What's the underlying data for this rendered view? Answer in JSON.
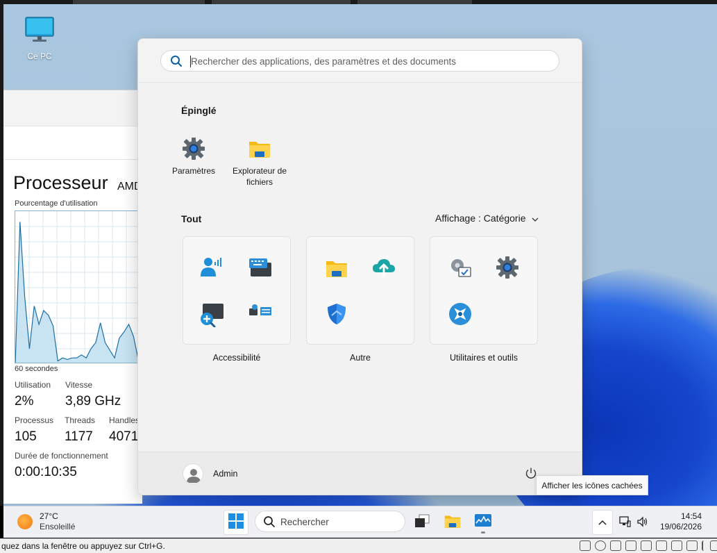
{
  "desktop": {
    "icon_label": "Ce PC"
  },
  "taskmgr": {
    "title": "Processeur",
    "model": "AMD",
    "graph_label": "Pourcentage d'utilisation",
    "graph_footer": "60 secondes",
    "stats": {
      "utilisation_label": "Utilisation",
      "utilisation_value": "2%",
      "vitesse_label": "Vitesse",
      "vitesse_value": "3,89 GHz",
      "processus_label": "Processus",
      "processus_value": "105",
      "threads_label": "Threads",
      "threads_value": "1177",
      "handles_label": "Handles",
      "handles_value": "4071",
      "uptime_label": "Durée de fonctionnement",
      "uptime_value": "0:00:10:35"
    },
    "graph_values": [
      0,
      93,
      44,
      10,
      38,
      26,
      35,
      32,
      25,
      2,
      4,
      3,
      4,
      4,
      6,
      4,
      10,
      14,
      27,
      14,
      9,
      4,
      17,
      21,
      26,
      18,
      3,
      3
    ]
  },
  "start_menu": {
    "search_placeholder": "Rechercher des applications, des paramètres et des documents",
    "pinned_title": "Épinglé",
    "pinned": [
      {
        "label": "Paramètres",
        "icon": "settings-gear-icon"
      },
      {
        "label": "Explorateur de fichiers",
        "icon": "file-explorer-icon"
      }
    ],
    "all_title": "Tout",
    "view_label": "Affichage : Catégorie",
    "categories": [
      {
        "label": "Accessibilité",
        "icons": [
          "narrator-icon",
          "on-screen-keyboard-icon",
          "magnifier-icon",
          "voice-access-icon"
        ]
      },
      {
        "label": "Autre",
        "icons": [
          "file-explorer-icon",
          "onedrive-upload-icon",
          "windows-security-icon"
        ]
      },
      {
        "label": "Utilitaires et outils",
        "icons": [
          "control-panel-icon",
          "settings-gear-icon",
          "system-tool-icon"
        ]
      }
    ],
    "user_name": "Admin"
  },
  "tooltip": "Afficher les icônes cachées",
  "taskbar": {
    "weather_temp": "27°C",
    "weather_cond": "Ensoleillé",
    "search_label": "Rechercher",
    "time": "14:54",
    "date": "19/06/2026"
  },
  "vm_status": "quez dans la fenêtre ou appuyez sur Ctrl+G."
}
